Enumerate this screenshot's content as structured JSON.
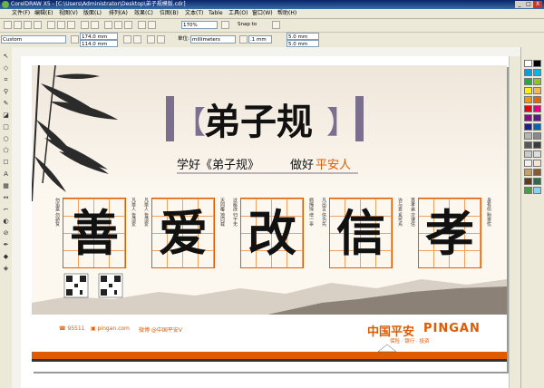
{
  "titlebar": {
    "text": "CorelDRAW X5 - [C:\\Users\\Administrator\\Desktop\\弟子规模版.cdr]",
    "minimize": "_",
    "restore": "□",
    "close": "X"
  },
  "menu": {
    "items": [
      "文件(F)",
      "编辑(E)",
      "视图(V)",
      "版面(L)",
      "排列(A)",
      "效果(C)",
      "位图(B)",
      "文本(T)",
      "Table",
      "工具(O)",
      "窗口(W)",
      "帮助(H)"
    ]
  },
  "toolbar1": {
    "zoom_value": "170%",
    "snap_label": "Snap to"
  },
  "toolbar2": {
    "paper_preset": "Custom",
    "width_value": "174.0 mm",
    "height_value": "114.0 mm",
    "units_label": "单位:",
    "units_value": "millimeters",
    "nudge_value": ".1 mm",
    "dup_x_value": "5.0 mm",
    "dup_y_value": "5.0 mm"
  },
  "artwork": {
    "title_chars": "弟子规",
    "bracket_left": "【",
    "bracket_right": "】",
    "subtitle": {
      "part1": "学好《弟子规》",
      "part2": "做好",
      "part3": "平安人"
    },
    "calligraphy": [
      {
        "char": "善",
        "left_note": "勿谄富 勿骄贫",
        "right_note": "凡是人 皆须爱"
      },
      {
        "char": "爱",
        "left_note": "凡是人 皆须爱",
        "right_note": "天同覆 地同载"
      },
      {
        "char": "改",
        "left_note": "过能改 归于无",
        "right_note": "倘掩饰 增一辜"
      },
      {
        "char": "信",
        "left_note": "凡出言 信为先",
        "right_note": "诈与妄 奚可焉"
      },
      {
        "char": "孝",
        "left_note": "首孝弟 次谨信",
        "right_note": "身有伤 贻亲忧"
      }
    ],
    "footer": {
      "phone": "95511",
      "website": "pingan.com",
      "weibo": "微博 @中国平安V",
      "brand_cn": "中国平安",
      "brand_en": "PINGAN",
      "slogan": "保险 · 银行 · 投资"
    },
    "colors": {
      "accent_orange": "#e05a00",
      "frame_purple": "#7b6f8e",
      "ink": "#111111",
      "paper": "#fcf7ef"
    }
  },
  "palette_colors": [
    "#ffffff",
    "#000000",
    "#00a0e9",
    "#00b7ee",
    "#22ac38",
    "#8fc31f",
    "#fff100",
    "#f8b551",
    "#f39800",
    "#eb6100",
    "#e60012",
    "#e4007f",
    "#920783",
    "#601986",
    "#1d2088",
    "#0068b7",
    "#b5b5b6",
    "#898989",
    "#595757",
    "#3e3a39",
    "#c9caca",
    "#dcdddd",
    "#efefef",
    "#f5e6d0",
    "#c8a063",
    "#8b5a2b",
    "#5e3c18",
    "#2c6e49",
    "#43a047",
    "#81d4fa"
  ]
}
